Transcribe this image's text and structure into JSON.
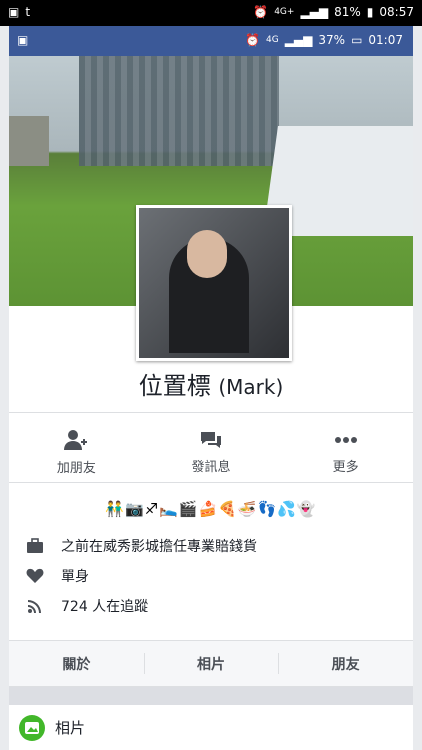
{
  "outer_status": {
    "battery": "81%",
    "time": "08:57",
    "network": "4G+"
  },
  "inner_status": {
    "battery": "37%",
    "time": "01:07",
    "network": "4G"
  },
  "profile": {
    "name_cjk": "位置標",
    "name_latin": "(Mark)"
  },
  "actions": [
    {
      "label": "加朋友",
      "icon": "add-friend-icon"
    },
    {
      "label": "發訊息",
      "icon": "message-icon"
    },
    {
      "label": "更多",
      "icon": "more-icon"
    }
  ],
  "emoji_bio": "👬📷♐🛌🎬🍰🍕🍜👣💦👻",
  "info": {
    "work": "之前在威秀影城擔任專業賠錢貨",
    "relationship": "單身",
    "followers": "724 人在追蹤"
  },
  "tabs": [
    "關於",
    "相片",
    "朋友"
  ],
  "photos_section": {
    "label": "相片",
    "icon": "photo-icon"
  },
  "colors": {
    "facebook_blue": "#3b5998",
    "photo_green": "#42b72a"
  }
}
